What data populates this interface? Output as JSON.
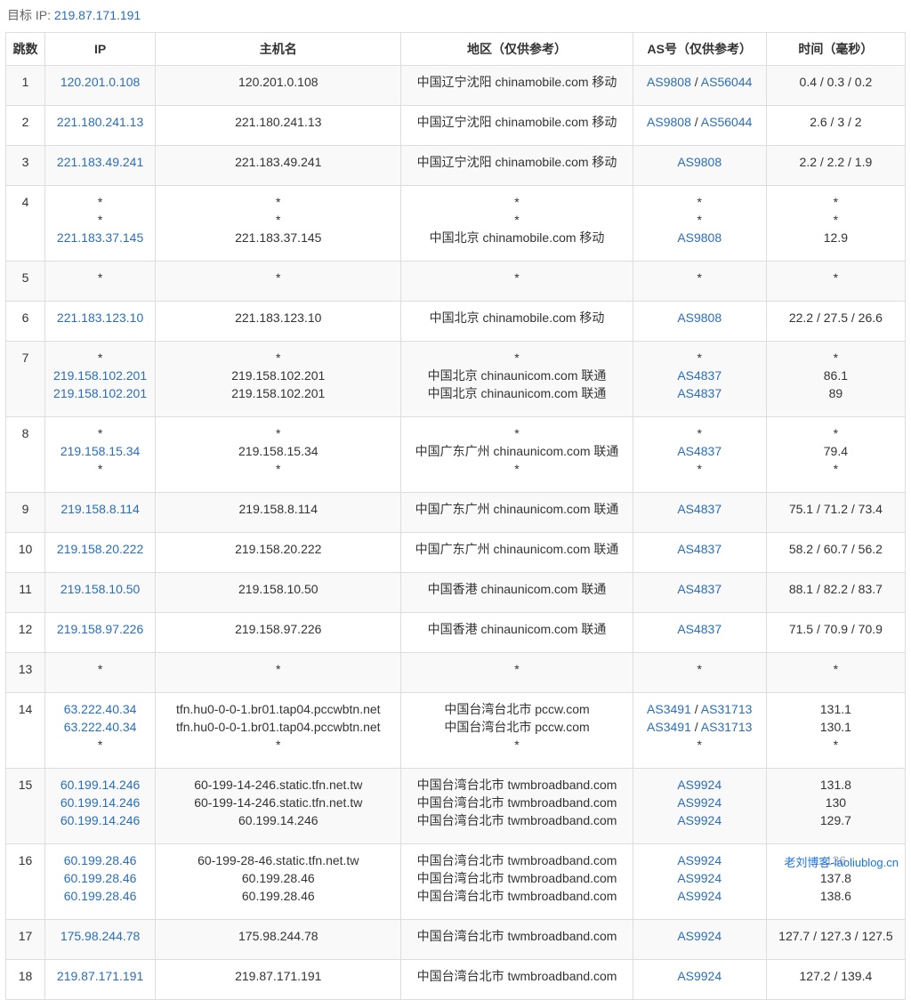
{
  "target": {
    "label": "目标 IP:",
    "ip": "219.87.171.191"
  },
  "headers": [
    "跳数",
    "IP",
    "主机名",
    "地区（仅供参考）",
    "AS号（仅供参考）",
    "时间（毫秒）"
  ],
  "watermark": "老刘博客-laoliublog.cn",
  "rows": [
    {
      "hop": "1",
      "ips": [
        "120.201.0.108"
      ],
      "hosts": [
        "120.201.0.108"
      ],
      "regions": [
        "中国辽宁沈阳 chinamobile.com 移动"
      ],
      "as": [
        [
          "AS9808",
          "AS56044"
        ]
      ],
      "times": [
        "0.4 / 0.3 / 0.2"
      ]
    },
    {
      "hop": "2",
      "ips": [
        "221.180.241.13"
      ],
      "hosts": [
        "221.180.241.13"
      ],
      "regions": [
        "中国辽宁沈阳 chinamobile.com 移动"
      ],
      "as": [
        [
          "AS9808",
          "AS56044"
        ]
      ],
      "times": [
        "2.6 / 3 / 2"
      ]
    },
    {
      "hop": "3",
      "ips": [
        "221.183.49.241"
      ],
      "hosts": [
        "221.183.49.241"
      ],
      "regions": [
        "中国辽宁沈阳 chinamobile.com 移动"
      ],
      "as": [
        [
          "AS9808"
        ]
      ],
      "times": [
        "2.2 / 2.2 / 1.9"
      ]
    },
    {
      "hop": "4",
      "ips": [
        "*",
        "*",
        "221.183.37.145"
      ],
      "hosts": [
        "*",
        "*",
        "221.183.37.145"
      ],
      "regions": [
        "*",
        "*",
        "中国北京 chinamobile.com 移动"
      ],
      "as": [
        [
          "*"
        ],
        [
          "*"
        ],
        [
          "AS9808"
        ]
      ],
      "times": [
        "*",
        "*",
        "12.9"
      ]
    },
    {
      "hop": "5",
      "ips": [
        "*"
      ],
      "hosts": [
        "*"
      ],
      "regions": [
        "*"
      ],
      "as": [
        [
          "*"
        ]
      ],
      "times": [
        "*"
      ]
    },
    {
      "hop": "6",
      "ips": [
        "221.183.123.10"
      ],
      "hosts": [
        "221.183.123.10"
      ],
      "regions": [
        "中国北京 chinamobile.com 移动"
      ],
      "as": [
        [
          "AS9808"
        ]
      ],
      "times": [
        "22.2 / 27.5 / 26.6"
      ]
    },
    {
      "hop": "7",
      "ips": [
        "*",
        "219.158.102.201",
        "219.158.102.201"
      ],
      "hosts": [
        "*",
        "219.158.102.201",
        "219.158.102.201"
      ],
      "regions": [
        "*",
        "中国北京 chinaunicom.com 联通",
        "中国北京 chinaunicom.com 联通"
      ],
      "as": [
        [
          "*"
        ],
        [
          "AS4837"
        ],
        [
          "AS4837"
        ]
      ],
      "times": [
        "*",
        "86.1",
        "89"
      ]
    },
    {
      "hop": "8",
      "ips": [
        "*",
        "219.158.15.34",
        "*"
      ],
      "hosts": [
        "*",
        "219.158.15.34",
        "*"
      ],
      "regions": [
        "*",
        "中国广东广州 chinaunicom.com 联通",
        "*"
      ],
      "as": [
        [
          "*"
        ],
        [
          "AS4837"
        ],
        [
          "*"
        ]
      ],
      "times": [
        "*",
        "79.4",
        "*"
      ]
    },
    {
      "hop": "9",
      "ips": [
        "219.158.8.114"
      ],
      "hosts": [
        "219.158.8.114"
      ],
      "regions": [
        "中国广东广州 chinaunicom.com 联通"
      ],
      "as": [
        [
          "AS4837"
        ]
      ],
      "times": [
        "75.1 / 71.2 / 73.4"
      ]
    },
    {
      "hop": "10",
      "ips": [
        "219.158.20.222"
      ],
      "hosts": [
        "219.158.20.222"
      ],
      "regions": [
        "中国广东广州 chinaunicom.com 联通"
      ],
      "as": [
        [
          "AS4837"
        ]
      ],
      "times": [
        "58.2 / 60.7 / 56.2"
      ]
    },
    {
      "hop": "11",
      "ips": [
        "219.158.10.50"
      ],
      "hosts": [
        "219.158.10.50"
      ],
      "regions": [
        "中国香港 chinaunicom.com 联通"
      ],
      "as": [
        [
          "AS4837"
        ]
      ],
      "times": [
        "88.1 / 82.2 / 83.7"
      ]
    },
    {
      "hop": "12",
      "ips": [
        "219.158.97.226"
      ],
      "hosts": [
        "219.158.97.226"
      ],
      "regions": [
        "中国香港 chinaunicom.com 联通"
      ],
      "as": [
        [
          "AS4837"
        ]
      ],
      "times": [
        "71.5 / 70.9 / 70.9"
      ]
    },
    {
      "hop": "13",
      "ips": [
        "*"
      ],
      "hosts": [
        "*"
      ],
      "regions": [
        "*"
      ],
      "as": [
        [
          "*"
        ]
      ],
      "times": [
        "*"
      ]
    },
    {
      "hop": "14",
      "ips": [
        "63.222.40.34",
        "63.222.40.34",
        "*"
      ],
      "hosts": [
        "tfn.hu0-0-0-1.br01.tap04.pccwbtn.net",
        "tfn.hu0-0-0-1.br01.tap04.pccwbtn.net",
        "*"
      ],
      "regions": [
        "中国台湾台北市 pccw.com",
        "中国台湾台北市 pccw.com",
        "*"
      ],
      "as": [
        [
          "AS3491",
          "AS31713"
        ],
        [
          "AS3491",
          "AS31713"
        ],
        [
          "*"
        ]
      ],
      "times": [
        "131.1",
        "130.1",
        "*"
      ]
    },
    {
      "hop": "15",
      "ips": [
        "60.199.14.246",
        "60.199.14.246",
        "60.199.14.246"
      ],
      "hosts": [
        "60-199-14-246.static.tfn.net.tw",
        "60-199-14-246.static.tfn.net.tw",
        "60.199.14.246"
      ],
      "regions": [
        "中国台湾台北市 twmbroadband.com",
        "中国台湾台北市 twmbroadband.com",
        "中国台湾台北市 twmbroadband.com"
      ],
      "as": [
        [
          "AS9924"
        ],
        [
          "AS9924"
        ],
        [
          "AS9924"
        ]
      ],
      "times": [
        "131.8",
        "130",
        "129.7"
      ]
    },
    {
      "hop": "16",
      "ips": [
        "60.199.28.46",
        "60.199.28.46",
        "60.199.28.46"
      ],
      "hosts": [
        "60-199-28-46.static.tfn.net.tw",
        "60.199.28.46",
        "60.199.28.46"
      ],
      "regions": [
        "中国台湾台北市 twmbroadband.com",
        "中国台湾台北市 twmbroadband.com",
        "中国台湾台北市 twmbroadband.com"
      ],
      "as": [
        [
          "AS9924"
        ],
        [
          "AS9924"
        ],
        [
          "AS9924"
        ]
      ],
      "times": [
        "136",
        "137.8",
        "138.6"
      ]
    },
    {
      "hop": "17",
      "ips": [
        "175.98.244.78"
      ],
      "hosts": [
        "175.98.244.78"
      ],
      "regions": [
        "中国台湾台北市 twmbroadband.com"
      ],
      "as": [
        [
          "AS9924"
        ]
      ],
      "times": [
        "127.7 / 127.3 / 127.5"
      ]
    },
    {
      "hop": "18",
      "ips": [
        "219.87.171.191"
      ],
      "hosts": [
        "219.87.171.191"
      ],
      "regions": [
        "中国台湾台北市 twmbroadband.com"
      ],
      "as": [
        [
          "AS9924"
        ]
      ],
      "times": [
        "127.2 / 139.4"
      ]
    }
  ]
}
